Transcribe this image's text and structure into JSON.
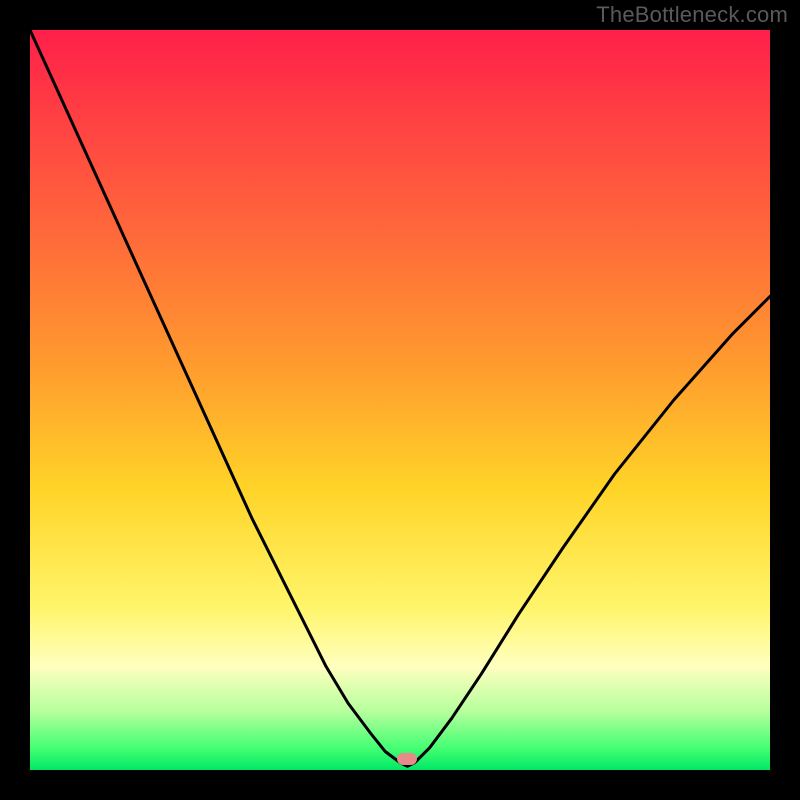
{
  "watermark": {
    "text": "TheBottleneck.com"
  },
  "chart_data": {
    "type": "line",
    "title": "",
    "xlabel": "",
    "ylabel": "",
    "xlim": [
      0,
      100
    ],
    "ylim": [
      0,
      100
    ],
    "background": "rainbow_vertical_gradient",
    "optimum_x": 51,
    "marker": {
      "x": 51,
      "y": 1.5,
      "color": "#e88a8a"
    },
    "series": [
      {
        "name": "bottleneck-curve",
        "x": [
          0,
          5,
          10,
          15,
          20,
          25,
          30,
          35,
          40,
          43,
          46,
          48,
          50,
          51,
          52,
          54,
          57,
          61,
          66,
          72,
          79,
          87,
          95,
          100
        ],
        "y": [
          100,
          89,
          78,
          67,
          56,
          45,
          34,
          24,
          14,
          9,
          5,
          2.5,
          1,
          0.5,
          1,
          3,
          7,
          13,
          21,
          30,
          40,
          50,
          59,
          64
        ]
      }
    ],
    "colors": {
      "curve": "#000000",
      "frame": "#000000",
      "gradient_stops": [
        "#ff1f4a",
        "#ff6a3a",
        "#ffd428",
        "#ffffbf",
        "#45ff73",
        "#00e865"
      ]
    }
  }
}
